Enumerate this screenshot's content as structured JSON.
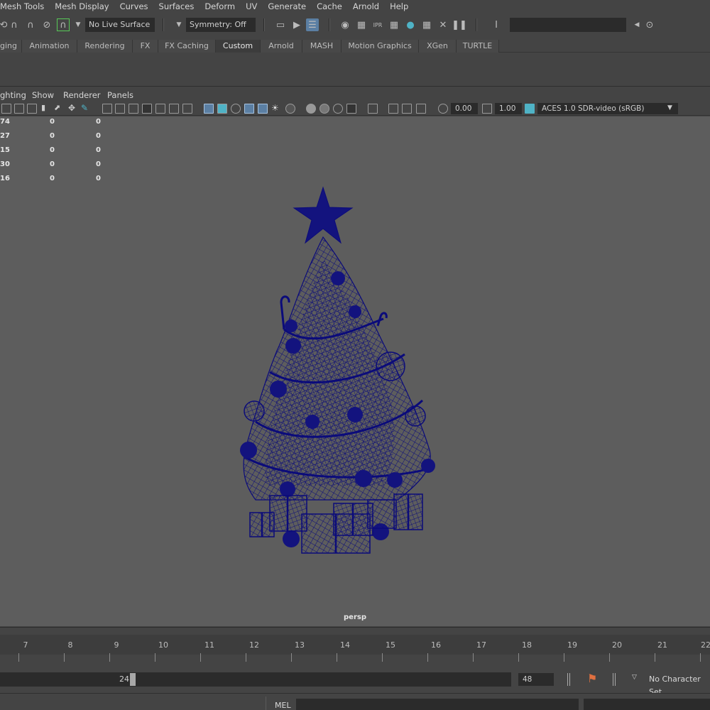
{
  "menus": [
    "Mesh Tools",
    "Mesh Display",
    "Curves",
    "Surfaces",
    "Deform",
    "UV",
    "Generate",
    "Cache",
    "Arnold",
    "Help"
  ],
  "status_line": {
    "live_surface": "No Live Surface",
    "symmetry": "Symmetry: Off",
    "command_field": ""
  },
  "shelf_tabs": [
    "ging",
    "Animation",
    "Rendering",
    "FX",
    "FX Caching",
    "Custom",
    "Arnold",
    "MASH",
    "Motion Graphics",
    "XGen",
    "TURTLE"
  ],
  "shelf_active": "Custom",
  "panel_menus": [
    "ghting",
    "Show",
    "Renderer",
    "Panels"
  ],
  "panel_toolbar": {
    "exposure": "0.00",
    "gamma": "1.00",
    "color_space": "ACES 1.0 SDR-video (sRGB)"
  },
  "hud_rows": [
    [
      "74",
      "0",
      "0"
    ],
    [
      "27",
      "0",
      "0"
    ],
    [
      "15",
      "0",
      "0"
    ],
    [
      "30",
      "0",
      "0"
    ],
    [
      "16",
      "0",
      "0"
    ]
  ],
  "camera": "persp",
  "wireframe_color": "#0b0b7a",
  "time_ticks": [
    "7",
    "8",
    "9",
    "10",
    "11",
    "12",
    "13",
    "14",
    "15",
    "16",
    "17",
    "18",
    "19",
    "20",
    "21",
    "22"
  ],
  "range": {
    "end_value": "24",
    "max_value": "48"
  },
  "character_set": "No Character Set",
  "command_line": {
    "label": "MEL"
  },
  "colors": {
    "ui_bg": "#444444",
    "viewport_bg": "#5d5d5d",
    "field_bg": "#2b2b2b",
    "highlight": "#5b7fa3",
    "key_marker": "#e07040"
  }
}
